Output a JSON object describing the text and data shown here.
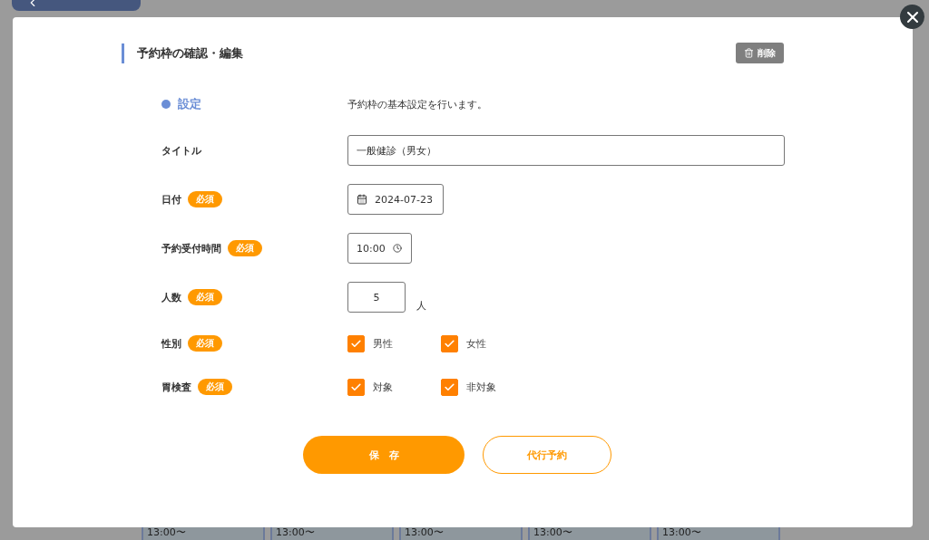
{
  "background": {
    "slots": [
      "13:00〜",
      "13:00〜",
      "13:00〜",
      "13:00〜",
      "13:00〜"
    ]
  },
  "dialog": {
    "title": "予約枠の確認・編集",
    "delete_button": "削除",
    "section": {
      "label": "設定",
      "description": "予約枠の基本設定を行います。"
    },
    "fields": [
      {
        "kind": "text",
        "label": "タイトル",
        "value": "一般健診（男女）"
      },
      {
        "kind": "date",
        "label": "日付",
        "badge": "必須",
        "value": "2024-07-23"
      },
      {
        "kind": "time",
        "label": "予約受付時間",
        "badge": "必須",
        "value": "10:00"
      },
      {
        "kind": "number",
        "label": "人数",
        "badge": "必須",
        "value": "5",
        "unit": "人"
      },
      {
        "kind": "checkboxes",
        "label": "性別",
        "badge": "必須",
        "options": [
          {
            "label": "男性",
            "checked": true
          },
          {
            "label": "女性",
            "checked": true
          }
        ]
      },
      {
        "kind": "checkboxes",
        "label": "胃検査",
        "badge": "必須",
        "options": [
          {
            "label": "対象",
            "checked": true
          },
          {
            "label": "非対象",
            "checked": true
          }
        ]
      }
    ],
    "buttons": [
      {
        "kind": "primary",
        "label": "保　存"
      },
      {
        "kind": "secondary",
        "label": "代行予約"
      }
    ]
  }
}
